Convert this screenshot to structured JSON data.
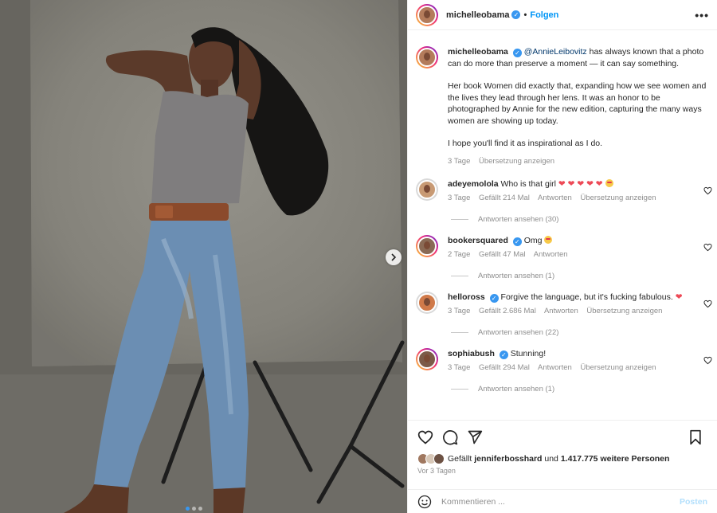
{
  "header": {
    "username": "michelleobama",
    "separator": "•",
    "follow_label": "Folgen",
    "more_label": "•••"
  },
  "caption": {
    "username": "michelleobama",
    "mention": "@AnnieLeibovitz",
    "text1": " has always known that a photo can do more than preserve a moment — it can say something.",
    "text2": "Her book Women did exactly that, expanding how we see women and the lives they lead through her lens. It was an honor to be photographed by Annie for the new edition, capturing the many ways women are showing up today.",
    "text3": "I hope you'll find it as inspirational as I do.",
    "time": "3 Tage",
    "translate": "Übersetzung anzeigen"
  },
  "comments": [
    {
      "user": "adeyemolola",
      "verified": false,
      "text": "Who is that girl",
      "emoji": "❤ ❤ ❤ ❤ ❤",
      "time": "3 Tage",
      "likes": "Gefällt 214 Mal",
      "reply": "Antworten",
      "translate": "Übersetzung anzeigen",
      "replies": "Antworten ansehen (30)"
    },
    {
      "user": "bookersquared",
      "verified": true,
      "text": "Omg",
      "emoji": "",
      "time": "2 Tage",
      "likes": "Gefällt 47 Mal",
      "reply": "Antworten",
      "translate": "",
      "replies": "Antworten ansehen (1)"
    },
    {
      "user": "helloross",
      "verified": true,
      "text": "Forgive the language, but it's fucking fabulous.",
      "emoji": "❤",
      "time": "3 Tage",
      "likes": "Gefällt 2.686 Mal",
      "reply": "Antworten",
      "translate": "Übersetzung anzeigen",
      "replies": "Antworten ansehen (22)"
    },
    {
      "user": "sophiabush",
      "verified": true,
      "text": "Stunning!",
      "emoji": "",
      "time": "3 Tage",
      "likes": "Gefällt 294 Mal",
      "reply": "Antworten",
      "translate": "Übersetzung anzeigen",
      "replies": "Antworten ansehen (1)"
    }
  ],
  "likes": {
    "prefix": "Gefällt ",
    "user": "jenniferbosshard",
    "middle": " und ",
    "count": "1.417.775 weitere Personen"
  },
  "date": "Vor 3 Tagen",
  "comment_input": {
    "placeholder": "Kommentieren ...",
    "post_label": "Posten"
  },
  "colors": {
    "accent": "#0095f6",
    "like_red": "#ed4956",
    "meta_gray": "#8e8e8e"
  }
}
